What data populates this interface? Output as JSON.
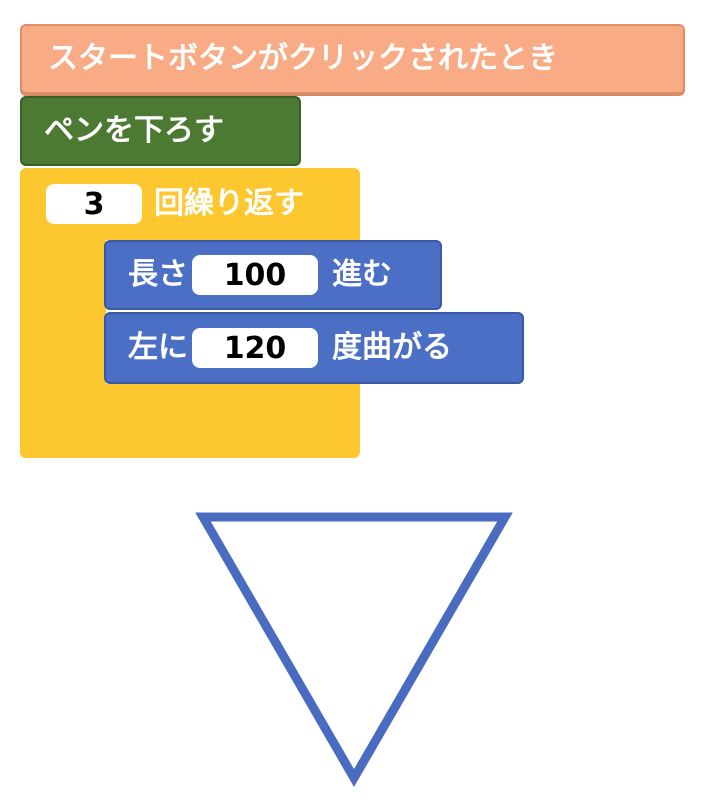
{
  "blocks": {
    "when_start": {
      "label": "スタートボタンがクリックされたとき",
      "color": "#f9ab85"
    },
    "pen_down": {
      "label": "ペンを下ろす",
      "color": "#4c7a33"
    },
    "repeat": {
      "count": "3",
      "label": "回繰り返す",
      "color": "#fcc72f"
    },
    "move": {
      "prefix": "長さ",
      "value": "100",
      "suffix": "進む",
      "color": "#4b6fc4"
    },
    "turn": {
      "prefix": "左に",
      "value": "120",
      "suffix": "度曲がる",
      "color": "#4b6fc4"
    }
  },
  "drawing": {
    "shape": "equilateral triangle",
    "stroke_color": "#4a6cc0"
  }
}
